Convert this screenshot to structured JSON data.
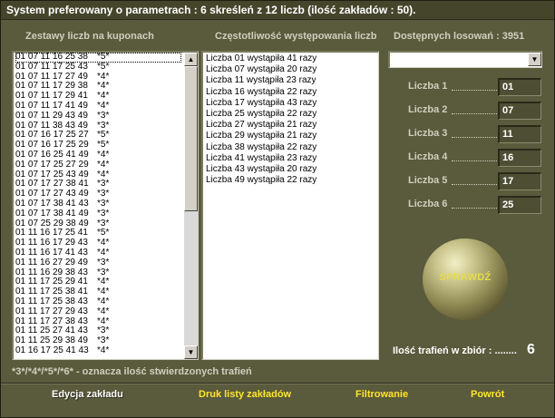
{
  "window": {
    "title": "System preferowany o parametrach : 6 skreśleń z 12 liczb (ilość zakładów : 50)."
  },
  "headers": {
    "sets": "Zestawy liczb na kuponach",
    "frequency": "Częstotliwość występowania liczb",
    "available": "Dostępnych losowań : 3951"
  },
  "sets_list": [
    {
      "numbers": "01 07 11 16 25 38",
      "hits": "*5*"
    },
    {
      "numbers": "01 07 11 17 25 43",
      "hits": "*5*"
    },
    {
      "numbers": "01 07 11 17 27 49",
      "hits": "*4*"
    },
    {
      "numbers": "01 07 11 17 29 38",
      "hits": "*4*"
    },
    {
      "numbers": "01 07 11 17 29 41",
      "hits": "*4*"
    },
    {
      "numbers": "01 07 11 17 41 49",
      "hits": "*4*"
    },
    {
      "numbers": "01 07 11 29 43 49",
      "hits": "*3*"
    },
    {
      "numbers": "01 07 11 38 43 49",
      "hits": "*3*"
    },
    {
      "numbers": "01 07 16 17 25 27",
      "hits": "*5*"
    },
    {
      "numbers": "01 07 16 17 25 29",
      "hits": "*5*"
    },
    {
      "numbers": "01 07 16 25 41 49",
      "hits": "*4*"
    },
    {
      "numbers": "01 07 17 25 27 29",
      "hits": "*4*"
    },
    {
      "numbers": "01 07 17 25 43 49",
      "hits": "*4*"
    },
    {
      "numbers": "01 07 17 27 38 41",
      "hits": "*3*"
    },
    {
      "numbers": "01 07 17 27 43 49",
      "hits": "*3*"
    },
    {
      "numbers": "01 07 17 38 41 43",
      "hits": "*3*"
    },
    {
      "numbers": "01 07 17 38 41 49",
      "hits": "*3*"
    },
    {
      "numbers": "01 07 25 29 38 49",
      "hits": "*3*"
    },
    {
      "numbers": "01 11 16 17 25 41",
      "hits": "*5*"
    },
    {
      "numbers": "01 11 16 17 29 43",
      "hits": "*4*"
    },
    {
      "numbers": "01 11 16 17 41 43",
      "hits": "*4*"
    },
    {
      "numbers": "01 11 16 27 29 49",
      "hits": "*3*"
    },
    {
      "numbers": "01 11 16 29 38 43",
      "hits": "*3*"
    },
    {
      "numbers": "01 11 17 25 29 41",
      "hits": "*4*"
    },
    {
      "numbers": "01 11 17 25 38 41",
      "hits": "*4*"
    },
    {
      "numbers": "01 11 17 25 38 43",
      "hits": "*4*"
    },
    {
      "numbers": "01 11 17 27 29 43",
      "hits": "*4*"
    },
    {
      "numbers": "01 11 17 27 38 43",
      "hits": "*4*"
    },
    {
      "numbers": "01 11 25 27 41 43",
      "hits": "*3*"
    },
    {
      "numbers": "01 11 25 29 38 49",
      "hits": "*3*"
    },
    {
      "numbers": "01 16 17 25 41 43",
      "hits": "*4*"
    }
  ],
  "frequency_list": [
    "Liczba 01 wystąpiła 41 razy",
    "Liczba 07 wystąpiła 20 razy",
    "Liczba 11 wystąpiła 23 razy",
    "Liczba 16 wystąpiła 22 razy",
    "Liczba 17 wystąpiła 43 razy",
    "Liczba 25 wystąpiła 22 razy",
    "Liczba 27 wystąpiła 21 razy",
    "Liczba 29 wystąpiła 21 razy",
    "Liczba 38 wystąpiła 22 razy",
    "Liczba 41 wystąpiła 23 razy",
    "Liczba 43 wystąpiła 20 razy",
    "Liczba 49 wystąpiła 22 razy"
  ],
  "draw_select": {
    "value": ""
  },
  "numbers": [
    {
      "label": "Liczba 1",
      "value": "01"
    },
    {
      "label": "Liczba 2",
      "value": "07"
    },
    {
      "label": "Liczba 3",
      "value": "11"
    },
    {
      "label": "Liczba 4",
      "value": "16"
    },
    {
      "label": "Liczba 5",
      "value": "17"
    },
    {
      "label": "Liczba 6",
      "value": "25"
    }
  ],
  "check_button": "SPRAWDŹ",
  "hits": {
    "label": "Ilość trafień w zbiór : ........",
    "value": "6"
  },
  "note": "*3*/*4*/*5*/*6* - oznacza ilość stwierdzonych trafień",
  "actions": {
    "edit": "Edycja zakładu",
    "print": "Druk listy zakładów",
    "filter": "Filtrowanie",
    "back": "Powrót"
  },
  "colors": {
    "background": "#5a5a3c",
    "accent_text": "#ffe62a",
    "label_text": "#cfcfbf"
  }
}
